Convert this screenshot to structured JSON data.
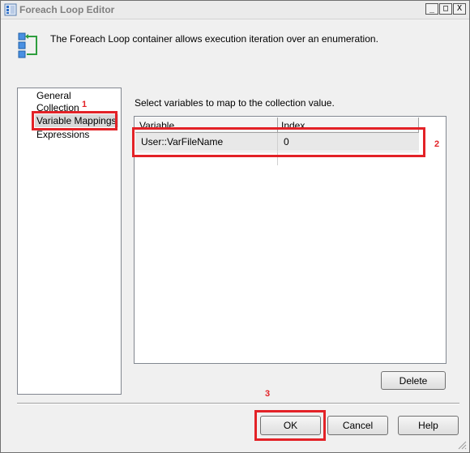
{
  "window": {
    "title": "Foreach Loop Editor",
    "controls": {
      "minimize": "_",
      "maximize": "□",
      "close": "X"
    }
  },
  "header": {
    "icon": "foreach-loop-icon",
    "description": "The Foreach Loop container allows execution iteration over an enumeration."
  },
  "nav": {
    "items": [
      "General",
      "Collection",
      "Variable Mappings",
      "Expressions"
    ],
    "selected": "Variable Mappings"
  },
  "content": {
    "label": "Select variables to map to the collection value.",
    "columns": [
      "Variable",
      "Index"
    ],
    "rows": [
      {
        "variable": "User::VarFileName",
        "index": "0"
      }
    ]
  },
  "buttons": {
    "delete": "Delete",
    "ok": "OK",
    "cancel": "Cancel",
    "help": "Help"
  },
  "annotations": [
    "1",
    "2",
    "3"
  ],
  "colors": {
    "highlight_red": "#e32227",
    "selection_gray": "#d9d9d9"
  }
}
